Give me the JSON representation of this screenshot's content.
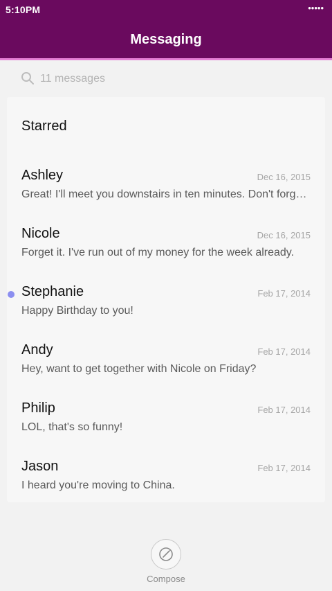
{
  "status_bar": {
    "time": "5:10PM",
    "signal_dots": "•••••"
  },
  "header": {
    "title": "Messaging"
  },
  "search": {
    "placeholder": "11 messages",
    "icon": "search-icon"
  },
  "starred": {
    "label": "Starred"
  },
  "conversations": [
    {
      "name": "Ashley",
      "date": "Dec 16, 2015",
      "preview": "Great! I'll meet you downstairs in ten minutes. Don't forget…",
      "unread": false
    },
    {
      "name": "Nicole",
      "date": "Dec 16, 2015",
      "preview": "Forget it. I've run out of my money for the week already.",
      "unread": false
    },
    {
      "name": "Stephanie",
      "date": "Feb 17, 2014",
      "preview": "Happy Birthday to you!",
      "unread": true
    },
    {
      "name": "Andy",
      "date": "Feb 17, 2014",
      "preview": "Hey, want to get together with Nicole on Friday?",
      "unread": false
    },
    {
      "name": "Philip",
      "date": "Feb 17, 2014",
      "preview": "LOL, that's so funny!",
      "unread": false
    },
    {
      "name": "Jason",
      "date": "Feb 17, 2014",
      "preview": "I heard you're moving to China.",
      "unread": false
    }
  ],
  "compose": {
    "label": "Compose",
    "icon": "compose-icon"
  },
  "colors": {
    "header_bg": "#6a0a5e",
    "header_accent": "#e47fd4",
    "unread_dot": "#8c8ff0"
  }
}
